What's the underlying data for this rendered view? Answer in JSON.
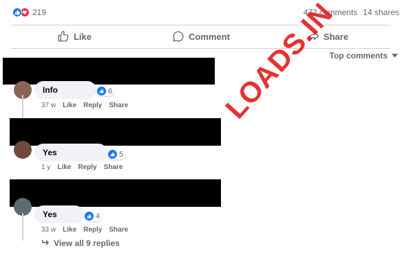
{
  "post_stats": {
    "reaction_count": "219",
    "comments": "472 comments",
    "shares": "14 shares"
  },
  "actions": {
    "like": "Like",
    "comment": "Comment",
    "share": "Share"
  },
  "sort": {
    "label": "Top comments"
  },
  "comments": [
    {
      "text": "Info",
      "reaction_count": "6",
      "time": "37 w",
      "like": "Like",
      "reply": "Reply",
      "share": "Share"
    },
    {
      "text": "Yes",
      "reaction_count": "5",
      "time": "1 y",
      "like": "Like",
      "reply": "Reply",
      "share": "Share"
    },
    {
      "text": "Yes",
      "reaction_count": "4",
      "time": "33 w",
      "like": "Like",
      "reply": "Reply",
      "share": "Share",
      "view_replies": "View all 9 replies"
    }
  ],
  "watermark": "LOADS.IN",
  "colors": {
    "like_blue": "#1877f2",
    "love_red": "#f02849",
    "watermark_red": "#e31c1c"
  },
  "icons": [
    "like-reaction-icon",
    "love-reaction-icon",
    "thumbs-up-icon",
    "comment-bubble-icon",
    "share-arrow-icon",
    "caret-down-icon",
    "reply-arrow-icon"
  ]
}
